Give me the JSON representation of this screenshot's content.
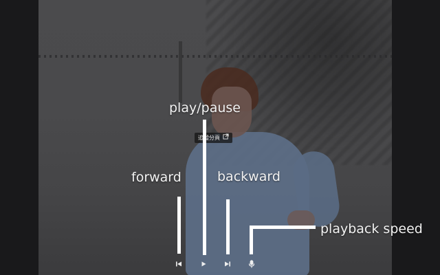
{
  "chip": {
    "label": "追蹤分頁"
  },
  "annotations": {
    "play_pause": "play/pause",
    "forward": "forward",
    "backward": "backward",
    "playback_speed": "playback speed"
  },
  "controls": [
    {
      "name": "skip-previous-icon"
    },
    {
      "name": "play-icon"
    },
    {
      "name": "skip-next-icon"
    },
    {
      "name": "microphone-icon"
    }
  ],
  "colors": {
    "annotation_text": "#f2f2f2",
    "annotation_line": "#ffffff",
    "background": "#18191b"
  }
}
